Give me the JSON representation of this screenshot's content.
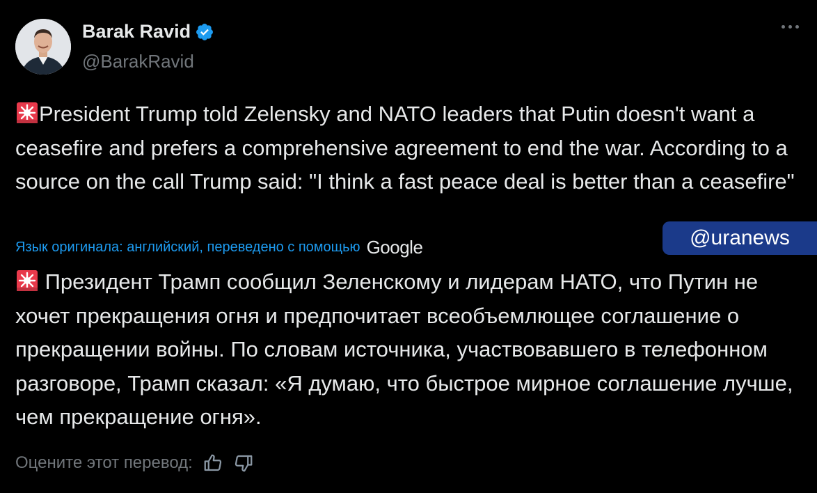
{
  "author": {
    "name": "Barak Ravid",
    "handle": "@BarakRavid",
    "verified": true
  },
  "icons": {
    "siren": "siren-emoji-icon",
    "verified": "verified-badge-icon",
    "more": "more-options-icon",
    "thumbs_up": "thumbs-up-icon",
    "thumbs_down": "thumbs-down-icon"
  },
  "tweet": {
    "text_en": "President Trump told Zelensky and NATO leaders that Putin doesn't want a ceasefire and prefers a comprehensive agreement to end the war. According to a source on the call Trump said: \"I think a fast peace deal is better than a ceasefire\"",
    "translation_note": "Язык оригинала: английский, переведено с помощью",
    "translation_provider": "Google",
    "text_ru": " Президент Трамп сообщил Зеленскому и лидерам НАТО, что Путин не хочет прекращения огня и предпочитает всеобъемлющее соглашение о прекращении войны. По словам источника, участвовавшего в телефонном разговоре, Трамп сказал: «Я думаю, что быстрое мирное соглашение лучше, чем прекращение огня».",
    "rate_translation": "Оцените этот перевод:"
  },
  "watermark": "@uranews",
  "colors": {
    "background": "#000000",
    "text": "#e7e9ea",
    "secondary": "#71767b",
    "link": "#1d9bf0",
    "verified": "#1d9bf0",
    "watermark_bg": "#1b3a8a"
  }
}
